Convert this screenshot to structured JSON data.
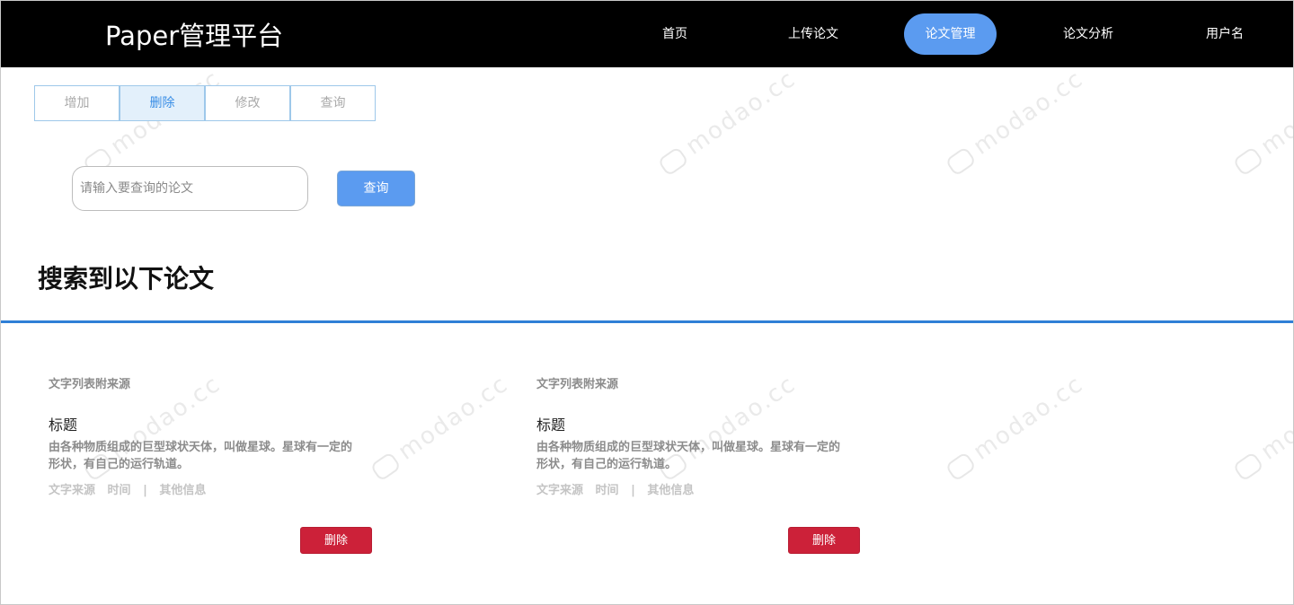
{
  "header": {
    "brand": "Paper管理平台",
    "nav": [
      {
        "label": "首页"
      },
      {
        "label": "上传论文"
      },
      {
        "label": "论文管理"
      },
      {
        "label": "论文分析"
      },
      {
        "label": "用户名"
      }
    ],
    "active_nav": "论文管理"
  },
  "tabs": [
    {
      "label": "增加"
    },
    {
      "label": "删除"
    },
    {
      "label": "修改"
    },
    {
      "label": "查询"
    }
  ],
  "active_tab": "删除",
  "search": {
    "placeholder": "请输入要查询的论文",
    "value": "",
    "button_label": "查询"
  },
  "results": {
    "heading": "搜索到以下论文",
    "cards": [
      {
        "source_tag": "文字列表附来源",
        "title": "标题",
        "description": "由各种物质组成的巨型球状天体，叫做星球。星球有一定的形状，有自己的运行轨道。",
        "meta_source": "文字来源",
        "meta_time": "时间",
        "meta_sep": "|",
        "meta_other": "其他信息",
        "delete_label": "删除"
      },
      {
        "source_tag": "文字列表附来源",
        "title": "标题",
        "description": "由各种物质组成的巨型球状天体，叫做星球。星球有一定的形状，有自己的运行轨道。",
        "meta_source": "文字来源",
        "meta_time": "时间",
        "meta_sep": "|",
        "meta_other": "其他信息",
        "delete_label": "删除"
      }
    ]
  },
  "watermark": "modao.cc",
  "colors": {
    "header_bg": "#000000",
    "nav_active": "#5b9bf0",
    "divider": "#2f7fd6",
    "delete": "#cc2139",
    "tab_border": "#9ec8ea"
  }
}
